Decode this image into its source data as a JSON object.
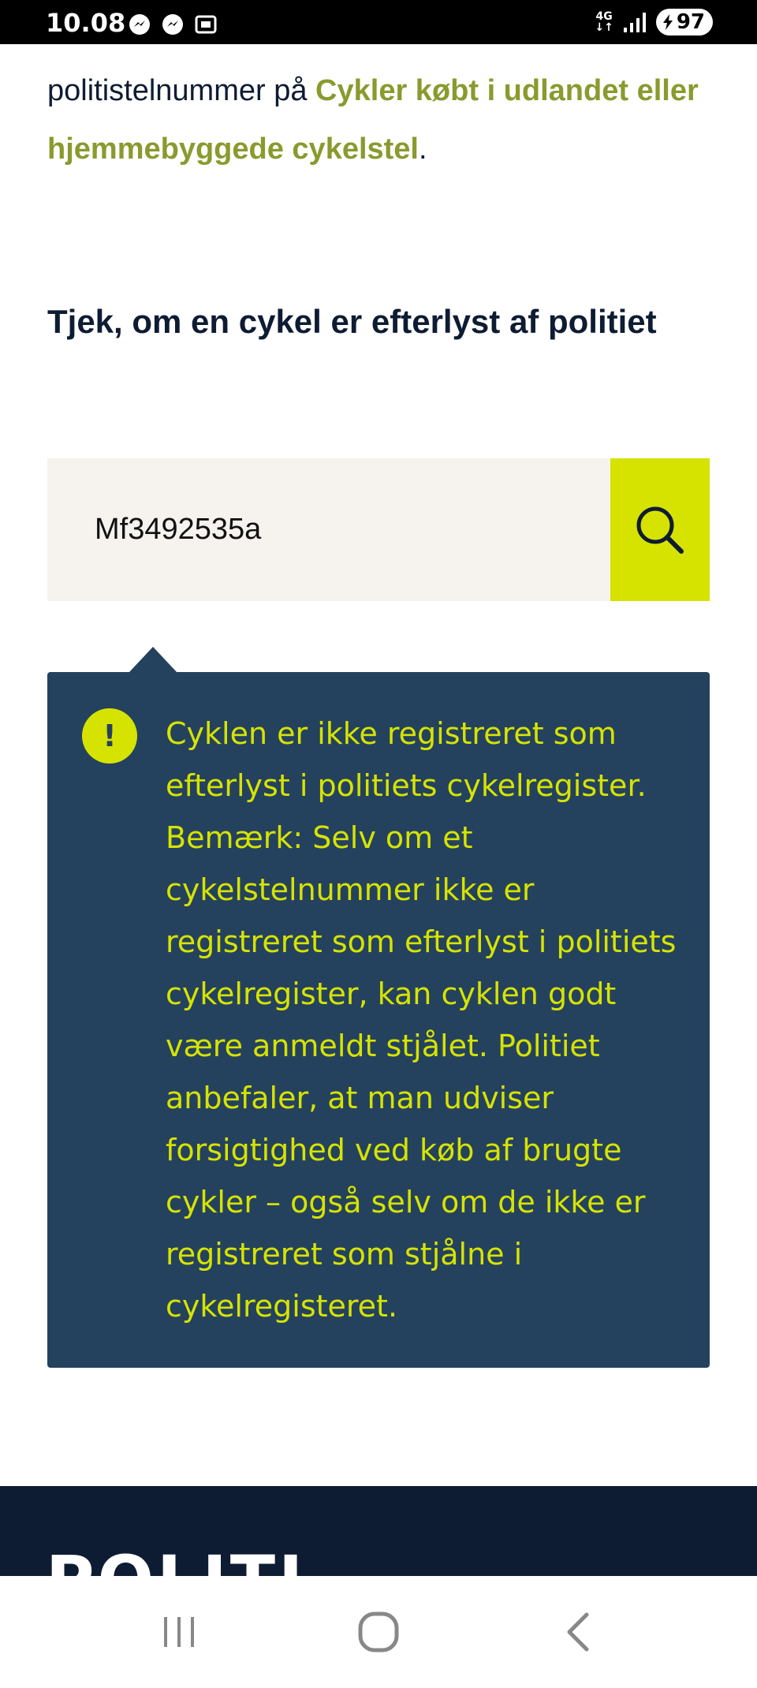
{
  "status_bar": {
    "time": "10.08",
    "network": "4G",
    "battery": "97",
    "notification_icons": [
      "messenger-icon",
      "messenger-icon",
      "screenshot-icon"
    ]
  },
  "intro": {
    "text_before": "politistelnummer på ",
    "link": "Cykler købt i udlandet eller hjemmebyggede cykelstel",
    "text_after": "."
  },
  "search": {
    "heading": "Tjek, om en cykel er efterlyst af politiet",
    "value": "Mf3492535a",
    "button_icon": "search-icon"
  },
  "result": {
    "icon": "!",
    "message": "Cyklen er ikke registreret som efterlyst i politiets cykelregister. Bemærk: Selv om et cykelstelnummer ikke er registreret som efterlyst i politiets cykelregister, kan cyklen godt være anmeldt stjålet. Politiet anbefaler, at man udviser forsigtighed ved køb af brugte cykler – også selv om de ikke er registreret som stjålne i cykelregisteret."
  },
  "footer": {
    "logo": "POLITI"
  },
  "colors": {
    "accent": "#d6e300",
    "alert_bg": "#24425e",
    "link": "#8a9a2e",
    "text": "#0e1c33",
    "footer_bg": "#0e1c33"
  }
}
